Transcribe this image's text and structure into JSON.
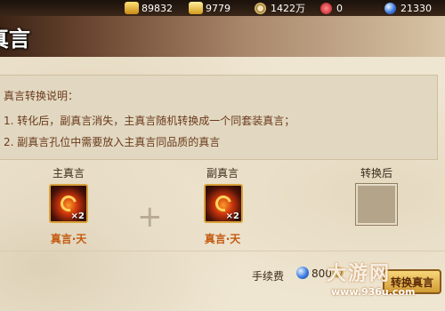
{
  "resources": {
    "gold": "89832",
    "ingot": "9779",
    "coin": "1422万",
    "heart": "0",
    "gem": "21330"
  },
  "header": {
    "title": "真言"
  },
  "description": {
    "heading": "真言转换说明：",
    "line1": "1. 转化后，副真言消失，主真言随机转换成一个同套装真言；",
    "line2": "2. 副真言孔位中需要放入主真言同品质的真言"
  },
  "slots": {
    "main": {
      "label": "主真言",
      "quantity": "×2",
      "name": "真言·天"
    },
    "secondary": {
      "label": "副真言",
      "quantity": "×2",
      "name": "真言·天"
    },
    "result": {
      "label": "转换后"
    }
  },
  "fee": {
    "label": "手续费",
    "gem_cost": "800",
    "button_label": "转换真言"
  },
  "watermark": {
    "text": "大游网",
    "url": "www.936u.com"
  }
}
